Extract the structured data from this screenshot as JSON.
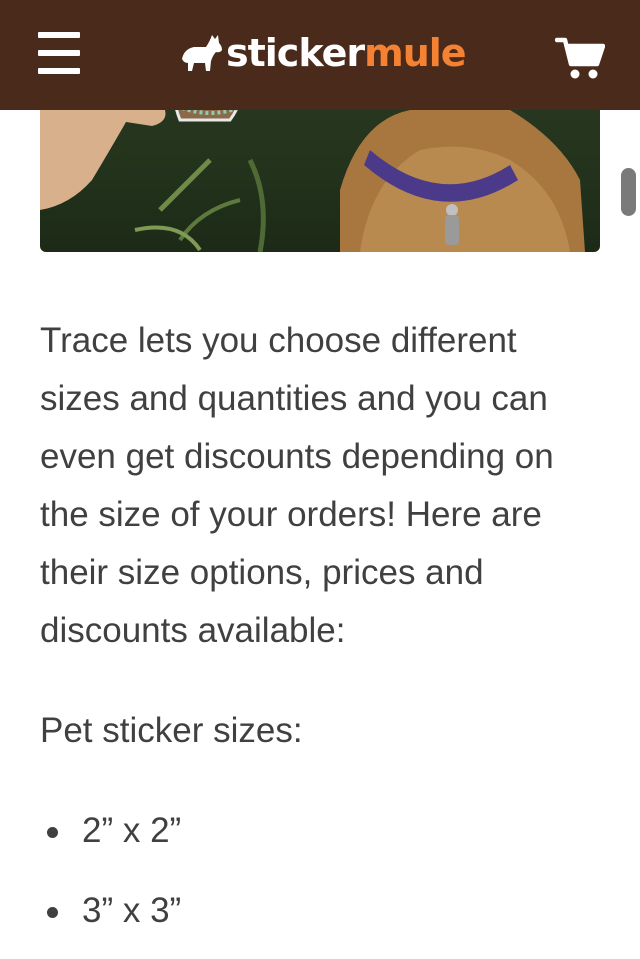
{
  "header": {
    "logo_part1": "sticker",
    "logo_part2": "mule",
    "menu_icon": "hamburger-menu-icon",
    "cart_icon": "shopping-cart-icon",
    "background_color": "#4a2a1a",
    "accent_color": "#f58233"
  },
  "article": {
    "paragraph": "Trace lets you choose different sizes and quantities and you can even get discounts depending on the size of your orders! Here are their size options, prices and discounts available:",
    "sizes_heading": "Pet sticker sizes:",
    "sizes": [
      {
        "label": "2” x 2”"
      },
      {
        "label": "3” x 3”"
      }
    ]
  }
}
